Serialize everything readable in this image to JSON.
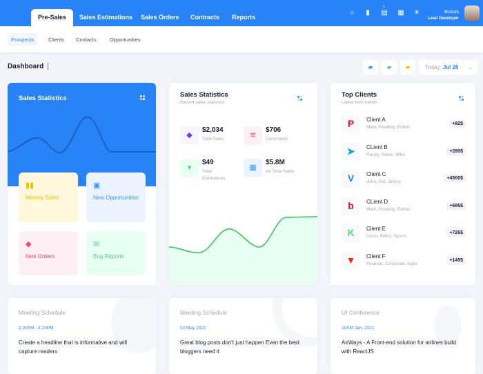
{
  "header": {
    "tabs": [
      "Pre-Sales",
      "Sales Estimations",
      "Sales Orders",
      "Contracts",
      "Reports"
    ],
    "user": {
      "name": "Mostafa",
      "role": "Lead Developer"
    }
  },
  "subnav": [
    "Prospects",
    "Clients",
    "Contacts",
    "Opportunities"
  ],
  "toolbar": {
    "title": "Dashboard",
    "date_label": "Today:",
    "date_value": "Jul 26"
  },
  "left_card": {
    "title": "Sales Statistics",
    "tiles": [
      {
        "label": "Weekly Sales",
        "color": "#f6c000"
      },
      {
        "label": "New Opportunities",
        "color": "#3699ff"
      },
      {
        "label": "Item Orders",
        "color": "#f1416c"
      },
      {
        "label": "Bug Reports",
        "color": "#50cd89"
      }
    ]
  },
  "mid_card": {
    "title": "Sales Statistics",
    "subtitle": "Recent sales statistics",
    "stats": [
      {
        "value": "$2,034",
        "label": "Total Sales"
      },
      {
        "value": "$706",
        "label": "Commision"
      },
      {
        "value": "$49",
        "label": "Total Estimations"
      },
      {
        "value": "$5.8M",
        "label": "All Time Sales"
      }
    ]
  },
  "clients_card": {
    "title": "Top Clients",
    "subtitle": "Latest tech trends",
    "clients": [
      {
        "name": "Client A",
        "people": "Mark, Rowling, Esther",
        "amount": "+82$"
      },
      {
        "name": "CLient B",
        "people": "Randy, Steve, Mike",
        "amount": "+280$"
      },
      {
        "name": "Client C",
        "people": "John, Pat, Jimmy",
        "amount": "+4500$"
      },
      {
        "name": "CLient D",
        "people": "Mark, Rowling, Esther",
        "amount": "+686$"
      },
      {
        "name": "Client E",
        "people": "Disco, Retro, Sports",
        "amount": "+726$"
      },
      {
        "name": "Client F",
        "people": "Finance, Corporate, Apps",
        "amount": "+145$"
      }
    ]
  },
  "bottom_cards": [
    {
      "title": "Meeting Schedule",
      "date": "3:30PM - 4:20PM",
      "text": "Create a headline that is informative and will capture readers"
    },
    {
      "title": "Meeting Schedule",
      "date": "03 May 2020",
      "text": "Great blog posts don't just happen Even the best bloggers need it"
    },
    {
      "title": "UI Conference",
      "date": "10AM Jan, 2021",
      "text": "AirWays - A Front-end solution for airlines build with ReactJS"
    }
  ],
  "colors": {
    "primary": "#2884f6",
    "background": "#f3f5fa"
  }
}
